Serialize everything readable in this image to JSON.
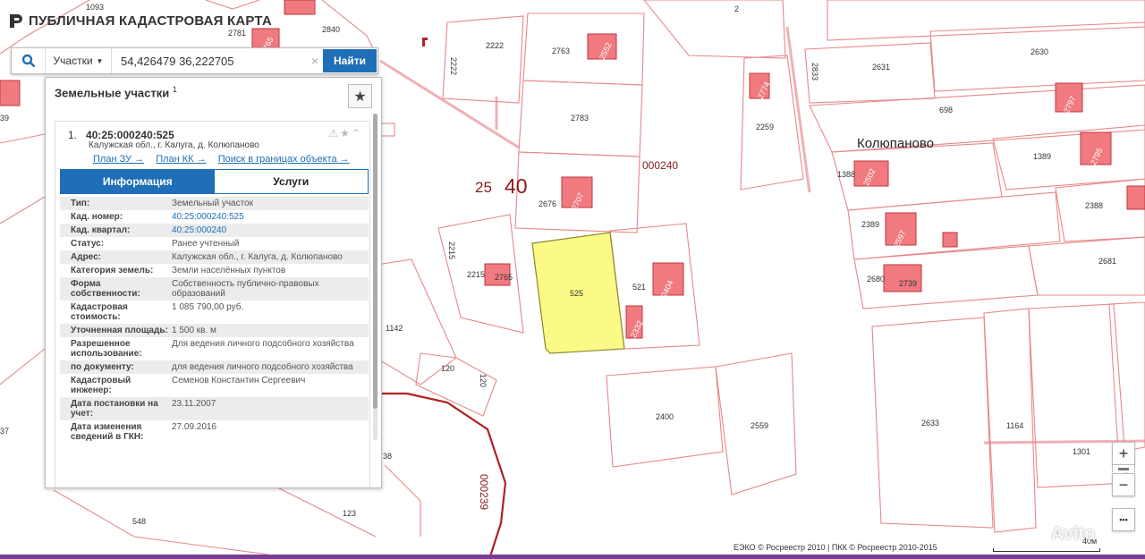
{
  "header": {
    "title": "ПУБЛИЧНАЯ КАДАСТРОВАЯ КАРТА"
  },
  "search": {
    "type_label": "Участки",
    "query": "54,426479 36,222705",
    "clear": "×",
    "find_label": "Найти"
  },
  "panel": {
    "title": "Земельные участки",
    "count": "1",
    "favorite_icon": "★",
    "card": {
      "index": "1.",
      "cad_number": "40:25:000240:525",
      "address": "Калужская обл., г. Калуга, д. Колюпаново",
      "links": [
        "План ЗУ →",
        "План КК →",
        "Поиск в границах объекта →"
      ],
      "tabs": {
        "info": "Информация",
        "services": "Услуги"
      },
      "props": [
        {
          "key": "Тип:",
          "value": "Земельный участок"
        },
        {
          "key": "Кад. номер:",
          "value": "40:25:000240:525"
        },
        {
          "key": "Кад. квартал:",
          "value": "40:25:000240"
        },
        {
          "key": "Статус:",
          "value": "Ранее учтенный"
        },
        {
          "key": "Адрес:",
          "value": "Калужская обл., г. Калуга, д. Колюпаново"
        },
        {
          "key": "Категория земель:",
          "value": "Земли населённых пунктов"
        },
        {
          "key": "Форма собственности:",
          "value": "Собственность публично-правовых образований"
        },
        {
          "key": "Кадастровая стоимость:",
          "value": "1 085 790,00 руб."
        },
        {
          "key": "Уточненная площадь:",
          "value": "1 500 кв. м"
        },
        {
          "key": "Разрешенное использование:",
          "value": "Для ведения личного подсобного хозяйства"
        },
        {
          "key": "по документу:",
          "value": "для ведения личного подсобного хозяйства"
        },
        {
          "key": "Кадастровый инженер:",
          "value": "Семенов Константин Сергеевич"
        },
        {
          "key": "Дата постановки на учет:",
          "value": "23.11.2007"
        },
        {
          "key": "Дата изменения сведений в ГКН:",
          "value": "27.09.2016"
        }
      ]
    }
  },
  "map": {
    "locality": "Колюпаново",
    "quarter_small": "25",
    "quarter_big": "40",
    "quarter_code": "000240",
    "quarter_code_rot": "000239",
    "labels": [
      "1093",
      "2781",
      "2840",
      "2",
      "2222",
      "2222",
      "2763",
      "2552",
      "2631",
      "2630",
      "2833",
      "2783",
      "698",
      "2259",
      "1389",
      "1388",
      "2388",
      "2676",
      "2389",
      "2215",
      "2215",
      "2765",
      "525",
      "521",
      "2681",
      "2680",
      "2739",
      "1142",
      "120",
      "120",
      "2400",
      "2559",
      "2633",
      "1164",
      "1301",
      "123",
      "548",
      "38",
      "37",
      "39"
    ],
    "building_labels": [
      "2552",
      "2774",
      "2502",
      "2707",
      "2795",
      "2597",
      "2739",
      "2765",
      "2797",
      "2404",
      "2332"
    ]
  },
  "controls": {
    "zoom_in": "+",
    "zoom_out": "−",
    "more": "•••"
  },
  "footer": {
    "attribution": "ЕЭКО © Росреестр 2010 | ПКК © Росреестр 2010-2015",
    "scale": "40м",
    "watermark": "Avito"
  }
}
